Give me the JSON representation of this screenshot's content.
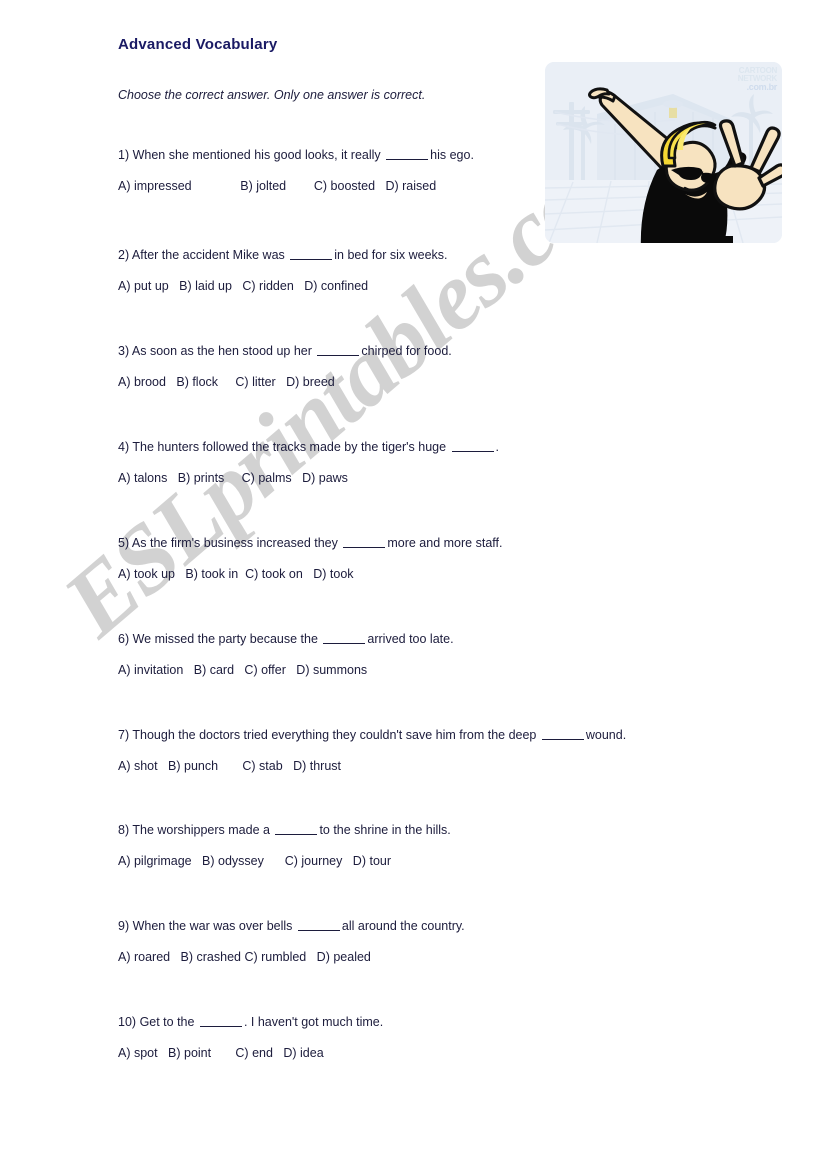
{
  "document": {
    "title": "Advanced Vocabulary",
    "instructions": "Choose the correct answer. Only one answer is correct.",
    "watermark": "ESLprintables.com"
  },
  "illustration": {
    "name": "johnny-bravo-cartoon",
    "watermark_line1": "CARTOON",
    "watermark_line2": "NETWORK",
    "watermark_line3": ".com.br"
  },
  "questions": [
    {
      "number": "1)",
      "text_before": "When she mentioned his good looks, it really",
      "text_after": "his ego.",
      "options": [
        {
          "label": "A)",
          "word": "impressed"
        },
        {
          "label": "B)",
          "word": "jolted"
        },
        {
          "label": "C)",
          "word": "boosted"
        },
        {
          "label": "D)",
          "word": "raised"
        }
      ],
      "options_line": "A) impressed              B) jolted        C) boosted   D) raised"
    },
    {
      "number": "2)",
      "text_before": "After the accident Mike was",
      "text_after": "in bed for six weeks.",
      "options": [
        {
          "label": "A)",
          "word": "put up"
        },
        {
          "label": "B)",
          "word": "laid up"
        },
        {
          "label": "C)",
          "word": "ridden"
        },
        {
          "label": "D)",
          "word": "confined"
        }
      ],
      "options_line": "A) put up   B) laid up   C) ridden   D) confined"
    },
    {
      "number": "3)",
      "text_before": "As soon as the hen stood up her",
      "text_after": "chirped for food.",
      "options": [
        {
          "label": "A)",
          "word": "brood"
        },
        {
          "label": "B)",
          "word": "flock"
        },
        {
          "label": "C)",
          "word": "litter"
        },
        {
          "label": "D)",
          "word": "breed"
        }
      ],
      "options_line": "A) brood   B) flock     C) litter   D) breed"
    },
    {
      "number": "4)",
      "text_before": "The hunters followed the tracks made by the tiger's huge",
      "text_after": ".",
      "options": [
        {
          "label": "A)",
          "word": "talons"
        },
        {
          "label": "B)",
          "word": "prints"
        },
        {
          "label": "C)",
          "word": "palms"
        },
        {
          "label": "D)",
          "word": "paws"
        }
      ],
      "options_line": "A) talons   B) prints     C) palms   D) paws"
    },
    {
      "number": "5)",
      "text_before": "As the firm's business increased they",
      "text_after": "more and more staff.",
      "options": [
        {
          "label": "A)",
          "word": "took up"
        },
        {
          "label": "B)",
          "word": "took in"
        },
        {
          "label": "C)",
          "word": "took on"
        },
        {
          "label": "D)",
          "word": "took"
        }
      ],
      "options_line": "A) took up   B) took in  C) took on   D) took"
    },
    {
      "number": "6)",
      "text_before": "We missed the party because the",
      "text_after": "arrived too late.",
      "options": [
        {
          "label": "A)",
          "word": "invitation"
        },
        {
          "label": "B)",
          "word": "card"
        },
        {
          "label": "C)",
          "word": "offer"
        },
        {
          "label": "D)",
          "word": "summons"
        }
      ],
      "options_line": "A) invitation   B) card   C) offer   D) summons"
    },
    {
      "number": "7)",
      "text_before": "Though the doctors tried everything they couldn't save him from the deep",
      "text_after": "wound.",
      "options": [
        {
          "label": "A)",
          "word": "shot"
        },
        {
          "label": "B)",
          "word": "punch"
        },
        {
          "label": "C)",
          "word": "stab"
        },
        {
          "label": "D)",
          "word": "thrust"
        }
      ],
      "options_line": "A) shot   B) punch       C) stab   D) thrust"
    },
    {
      "number": "8)",
      "text_before": "The worshippers made a",
      "text_after": "to the shrine in the hills.",
      "options": [
        {
          "label": "A)",
          "word": "pilgrimage"
        },
        {
          "label": "B)",
          "word": "odyssey"
        },
        {
          "label": "C)",
          "word": "journey"
        },
        {
          "label": "D)",
          "word": "tour"
        }
      ],
      "options_line": "A) pilgrimage   B) odyssey      C) journey   D) tour"
    },
    {
      "number": "9)",
      "text_before": "When the war was over bells",
      "text_after": "all around the country.",
      "options": [
        {
          "label": "A)",
          "word": "roared"
        },
        {
          "label": "B)",
          "word": "crashed"
        },
        {
          "label": "C)",
          "word": "rumbled"
        },
        {
          "label": "D)",
          "word": "pealed"
        }
      ],
      "options_line": "A) roared   B) crashed C) rumbled   D) pealed"
    },
    {
      "number": "10)",
      "text_before": "Get to the",
      "text_after": ". I haven't got much time.",
      "options": [
        {
          "label": "A)",
          "word": "spot"
        },
        {
          "label": "B)",
          "word": "point"
        },
        {
          "label": "C)",
          "word": "end"
        },
        {
          "label": "D)",
          "word": "idea"
        }
      ],
      "options_line": "A) spot   B) point       C) end   D) idea"
    }
  ],
  "layout": {
    "question_tops": [
      148,
      248,
      344,
      440,
      536,
      632,
      728,
      823,
      919,
      1015
    ]
  },
  "colors": {
    "title": "#1a1a64",
    "body_text": "#1c1c3c",
    "watermark": "#d2d2d2",
    "illustration_bg": "#eaeff6",
    "page_bg": "#ffffff"
  }
}
